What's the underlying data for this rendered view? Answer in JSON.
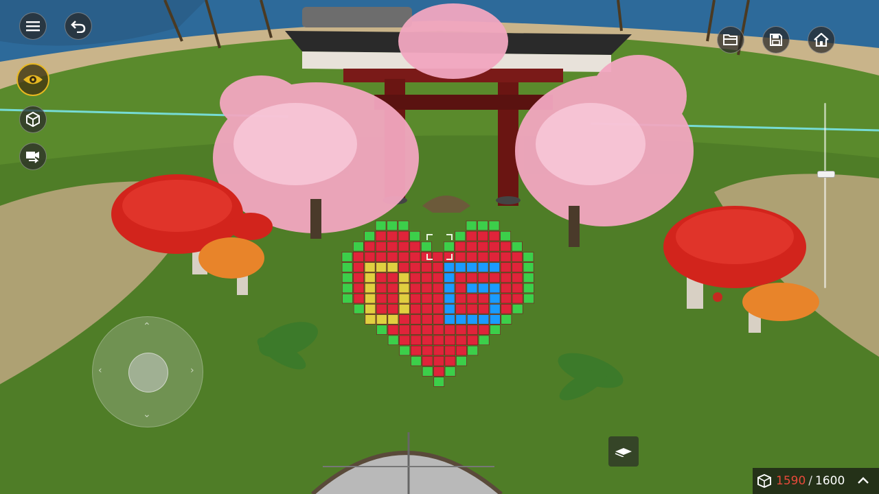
{
  "hud": {
    "block_count": "1590",
    "separator": "/",
    "block_limit": "1600"
  },
  "buttons": {
    "menu": "menu-icon",
    "undo": "undo-icon",
    "view_mode": "eye-icon",
    "blocks": "cube-icon",
    "camera": "camera-swap-icon",
    "open": "folder-icon",
    "save": "save-icon",
    "home": "home-icon",
    "layer": "layer-icon",
    "expand": "chevron-up-icon"
  },
  "zoom_level": 0.62,
  "colors": {
    "accent": "#e8b820",
    "count_current": "#e84a3a",
    "heart_red": "#e0243a",
    "glow_yellow": "#e0d040",
    "glow_blue": "#1a9cff",
    "border_green": "#3ccf4a"
  }
}
